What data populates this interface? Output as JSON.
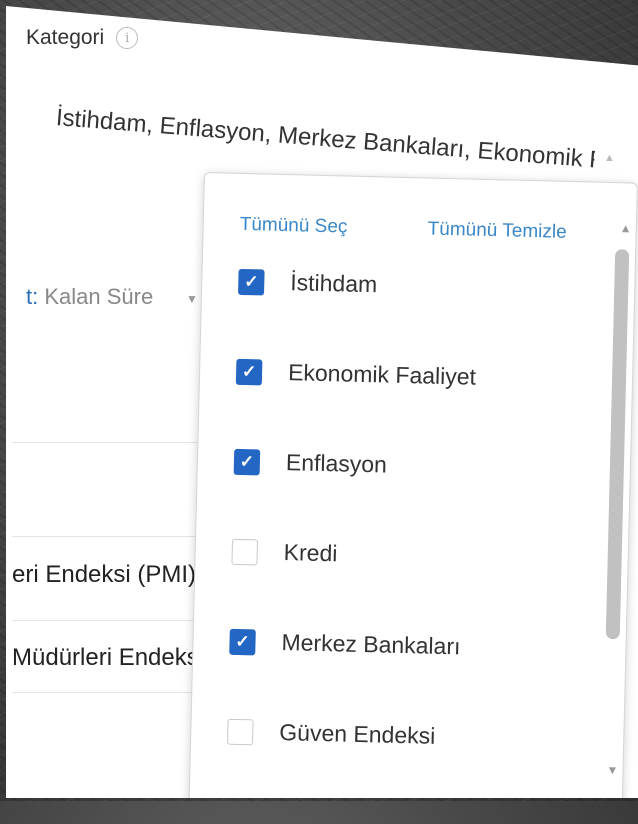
{
  "filter": {
    "title": "Kategori",
    "info_icon": "i",
    "selected_value": "İstihdam, Enflasyon, Merkez Bankaları, Ekonomik Faaliyet",
    "select_arrow": "▲"
  },
  "sort": {
    "prefix": "t:",
    "value": "Kalan Süre",
    "caret": "▼"
  },
  "background_rows": [
    "eri Endeksi (PMI)",
    "Müdürleri Endeksi"
  ],
  "dropdown": {
    "select_all": "Tümünü Seç",
    "clear_all": "Tümünü Temizle",
    "scroll_up": "▲",
    "scroll_down": "▼",
    "options": [
      {
        "label": "İstihdam",
        "checked": true
      },
      {
        "label": "Ekonomik Faaliyet",
        "checked": true
      },
      {
        "label": "Enflasyon",
        "checked": true
      },
      {
        "label": "Kredi",
        "checked": false
      },
      {
        "label": "Merkez Bankaları",
        "checked": true
      },
      {
        "label": "Güven Endeksi",
        "checked": false
      }
    ]
  },
  "colors": {
    "accent": "#2466c4",
    "link": "#3a87c8"
  }
}
